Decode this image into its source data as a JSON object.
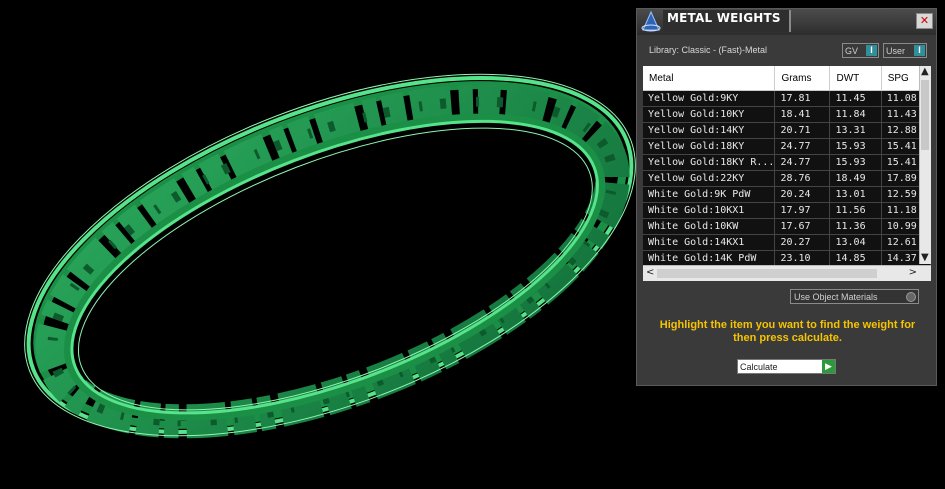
{
  "window": {
    "title": "METAL WEIGHTS",
    "close_glyph": "✕",
    "logo_icon": "rhino-logo-icon"
  },
  "library": {
    "label": "Library: Classic - (Fast)-Metal"
  },
  "toggles": {
    "gv": "GV",
    "user": "User",
    "knob": "I"
  },
  "table": {
    "columns": [
      "Metal",
      "Grams",
      "DWT",
      "SPG"
    ],
    "rows": [
      [
        "Yellow Gold:9KY",
        "17.81",
        "11.45",
        "11.08"
      ],
      [
        "Yellow Gold:10KY",
        "18.41",
        "11.84",
        "11.43"
      ],
      [
        "Yellow Gold:14KY",
        "20.71",
        "13.31",
        "12.88"
      ],
      [
        "Yellow Gold:18KY",
        "24.77",
        "15.93",
        "15.41"
      ],
      [
        "Yellow Gold:18KY R...",
        "24.77",
        "15.93",
        "15.41"
      ],
      [
        "Yellow Gold:22KY",
        "28.76",
        "18.49",
        "17.89"
      ],
      [
        "White Gold:9K PdW",
        "20.24",
        "13.01",
        "12.59"
      ],
      [
        "White Gold:10KX1",
        "17.97",
        "11.56",
        "11.18"
      ],
      [
        "White Gold:10KW",
        "17.67",
        "11.36",
        "10.99"
      ],
      [
        "White Gold:14KX1",
        "20.27",
        "13.04",
        "12.61"
      ],
      [
        "White Gold:14K PdW",
        "23.10",
        "14.85",
        "14.37"
      ]
    ]
  },
  "use_object_materials": "Use Object Materials",
  "hint": "Highlight the item you want to find the weight for then press calculate.",
  "calculate": {
    "label": "Calculate",
    "go_glyph": "▶"
  },
  "colors": {
    "model": "#1f9a4e",
    "model_edge": "#55e68a",
    "hint": "#f5c400",
    "accent": "#2f8f9a"
  }
}
